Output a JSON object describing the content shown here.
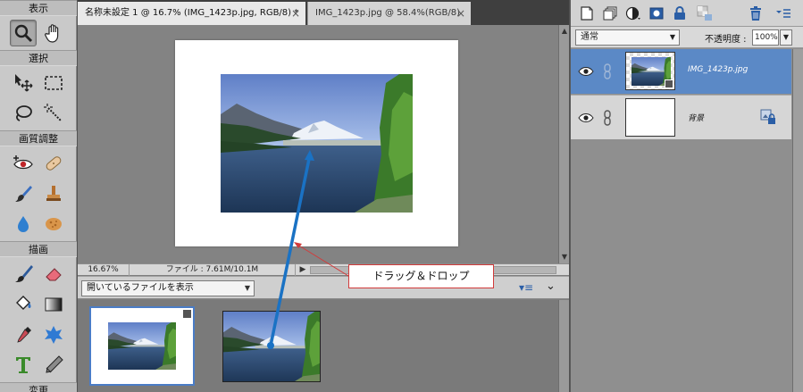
{
  "toolbox": {
    "sections": {
      "view": "表示",
      "select": "選択",
      "enhance": "画質調整",
      "draw": "描画",
      "modify": "変更"
    },
    "tools": [
      "zoom-icon",
      "hand-icon",
      "move-icon",
      "marquee-icon",
      "lasso-icon",
      "magic-wand-icon",
      "red-eye-icon",
      "healing-brush-icon",
      "smart-brush-icon",
      "clone-stamp-icon",
      "blur-icon",
      "sponge-icon",
      "brush-icon",
      "eraser-icon",
      "paint-bucket-icon",
      "gradient-icon",
      "eyedropper-icon",
      "custom-shape-icon",
      "type-icon",
      "pencil-icon"
    ],
    "selected_tool": "zoom-icon"
  },
  "tabs": [
    {
      "label": "名称未設定 1 @ 16.7% (IMG_1423p.jpg, RGB/8) *",
      "close": "×",
      "active": true
    },
    {
      "label": "IMG_1423p.jpg @ 58.4%(RGB/8)",
      "close": "×",
      "active": false
    }
  ],
  "status": {
    "zoom": "16.67%",
    "file_info": "ファイル : 7.61M/10.1M",
    "arrow": "▶"
  },
  "photo_bin": {
    "selector_value": "開いているファイルを表示",
    "dropdown_arrow": "▼",
    "menu_glyph": "▾≡",
    "collapse_glyph": "⌄"
  },
  "layers_panel": {
    "blend_mode": "通常",
    "opacity_label": "不透明度 :",
    "opacity_value": "100%",
    "layers": [
      {
        "name": "IMG_1423p.jpg",
        "selected": true
      },
      {
        "name": "背景",
        "selected": false
      }
    ]
  },
  "annotation": {
    "text": "ドラッグ＆ドロップ"
  },
  "colors": {
    "drag_arrow": "#1a72c4",
    "callout_line": "#d23b3b",
    "selected_layer": "#5b89c6",
    "selected_thumb_border": "#4a7cc6"
  }
}
